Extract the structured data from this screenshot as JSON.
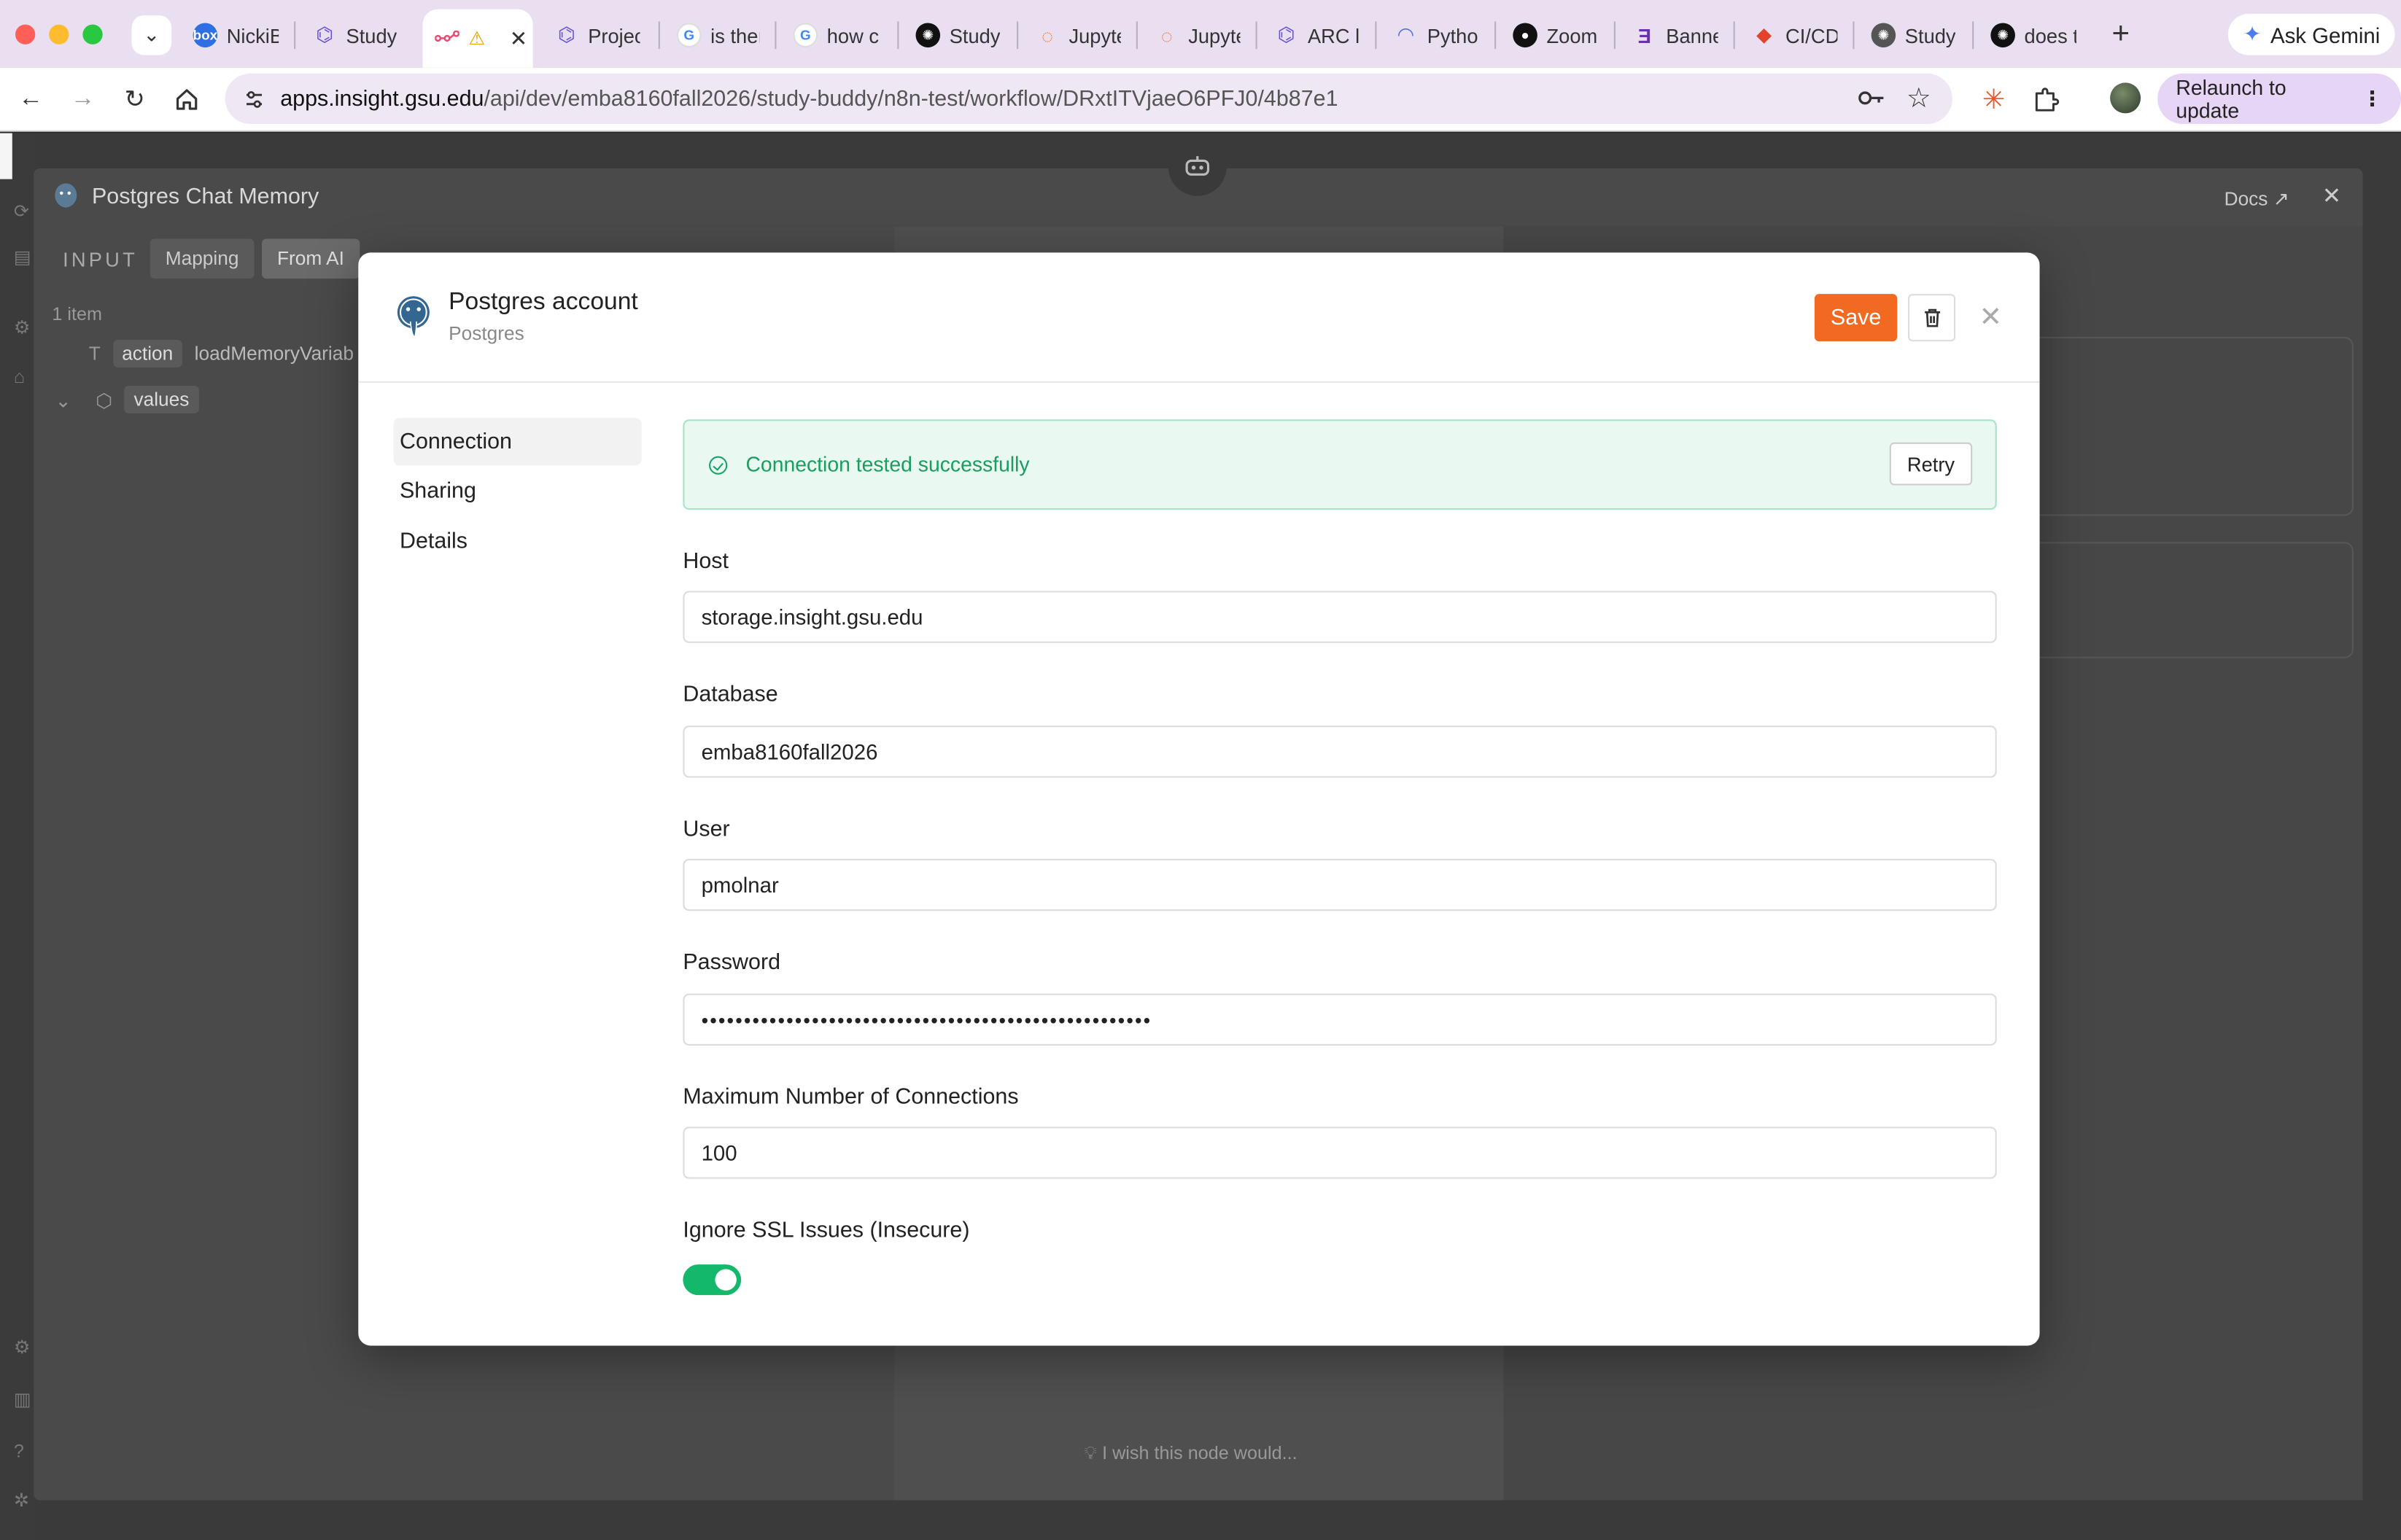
{
  "browser": {
    "tabs": [
      {
        "title": "NickiB",
        "icon": "box-icon",
        "color": "#2f6fe4"
      },
      {
        "title": "Study",
        "icon": "arc-icon",
        "color": "#6b4fd6"
      },
      {
        "title": "",
        "icon": "n8n-icon",
        "color": "#ea4b71",
        "warning": "⚠"
      },
      {
        "title": "Projec",
        "icon": "arc-icon",
        "color": "#6b4fd6"
      },
      {
        "title": "is ther",
        "icon": "google-icon",
        "color": "#4285f4"
      },
      {
        "title": "how c",
        "icon": "google-icon",
        "color": "#4285f4"
      },
      {
        "title": "Study",
        "icon": "openai-icon",
        "color": "#111111"
      },
      {
        "title": "Jupyte",
        "icon": "jupyter-icon",
        "color": "#f37726"
      },
      {
        "title": "Jupyte",
        "icon": "jupyter-icon",
        "color": "#f37726"
      },
      {
        "title": "ARC lo",
        "icon": "arc-icon",
        "color": "#6b4fd6"
      },
      {
        "title": "Pytho",
        "icon": "rainbow-icon",
        "color": "#5a6fd6"
      },
      {
        "title": "Zoom",
        "icon": "zoom-icon",
        "color": "#111111"
      },
      {
        "title": "Banne",
        "icon": "banner-icon",
        "color": "#6b2fb3"
      },
      {
        "title": "CI/CD",
        "icon": "gitlab-icon",
        "color": "#e2432a"
      },
      {
        "title": "Study",
        "icon": "openai-icon",
        "color": "#555555"
      },
      {
        "title": "does t",
        "icon": "openai-icon",
        "color": "#111111"
      }
    ],
    "new_tab": "+",
    "gemini_label": "Ask Gemini",
    "url_host": "apps.insight.gsu.edu",
    "url_path": "/api/dev/emba8160fall2026/study-buddy/n8n-test/workflow/DRxtITVjaeO6PFJ0/4b87e1",
    "relaunch_label": "Relaunch to update"
  },
  "ndv": {
    "title": "Postgres Chat Memory",
    "docs_label": "Docs",
    "input_label": "INPUT",
    "mapping_label": "Mapping",
    "from_ai_label": "From AI",
    "item_count": "1 item",
    "rows": [
      {
        "key": "action",
        "value": "loadMemoryVariab",
        "type_icon": "T"
      },
      {
        "key": "values",
        "value": "",
        "type_icon": "⬡"
      }
    ],
    "wish_text": "I wish this node would..."
  },
  "modal": {
    "title": "Postgres account",
    "subtitle": "Postgres",
    "save_label": "Save",
    "sidebar": [
      {
        "label": "Connection",
        "active": true
      },
      {
        "label": "Sharing",
        "active": false
      },
      {
        "label": "Details",
        "active": false
      }
    ],
    "status_message": "Connection tested successfully",
    "retry_label": "Retry",
    "fields": {
      "host": {
        "label": "Host",
        "value": "storage.insight.gsu.edu"
      },
      "database": {
        "label": "Database",
        "value": "emba8160fall2026"
      },
      "user": {
        "label": "User",
        "value": "pmolnar"
      },
      "password": {
        "label": "Password",
        "value": "•••••••••••••••••••••••••••••••••••••••••••••••••••••"
      },
      "max_connections": {
        "label": "Maximum Number of Connections",
        "value": "100"
      },
      "ignore_ssl": {
        "label": "Ignore SSL Issues (Insecure)",
        "enabled": true
      }
    }
  }
}
